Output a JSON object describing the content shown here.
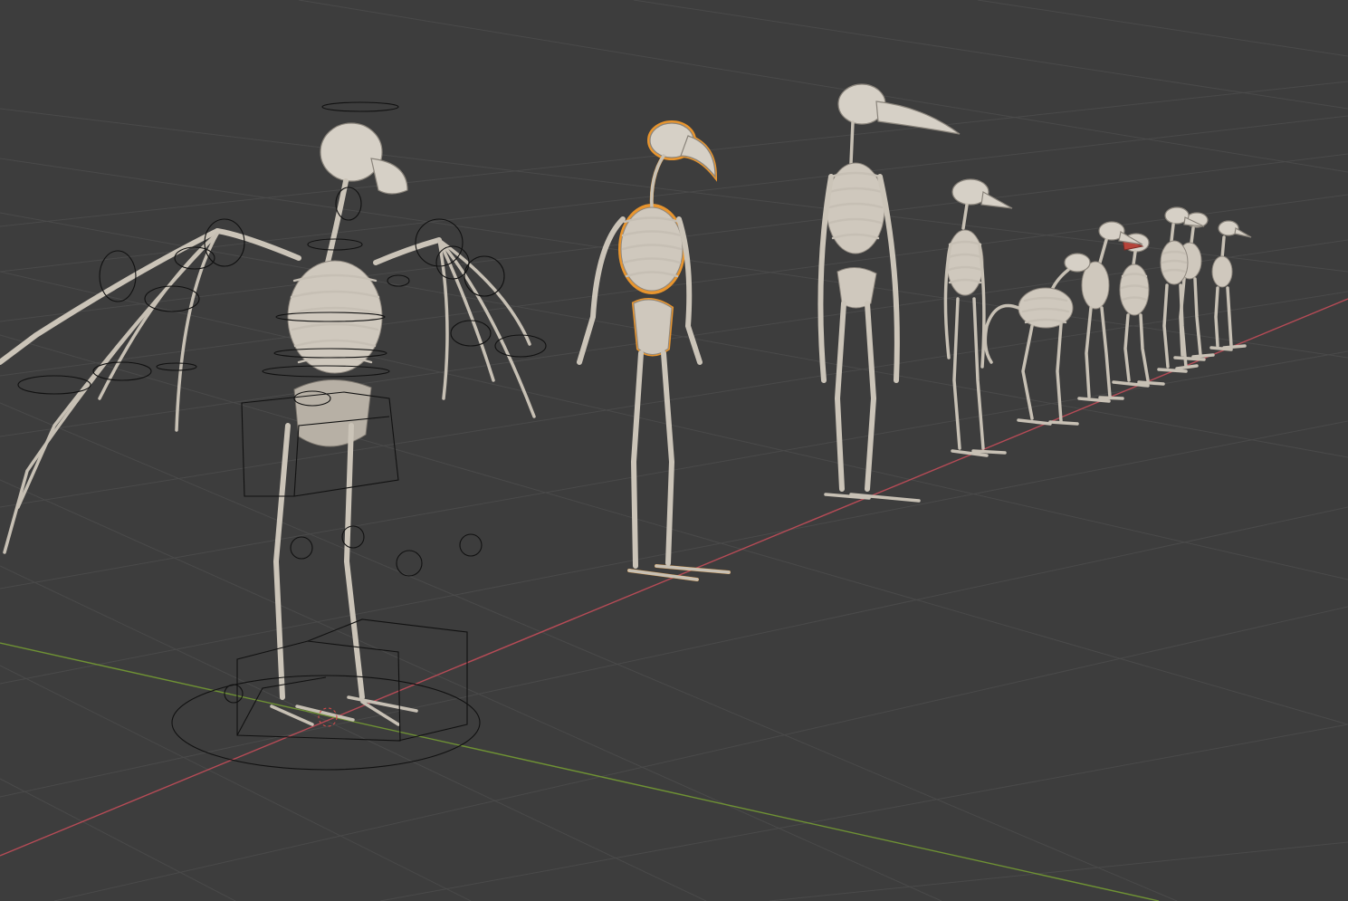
{
  "viewport": {
    "background": "#3d3d3d",
    "grid_color": "#4a4a4a",
    "x_axis_color": "#b64b56",
    "y_axis_color": "#6f9234",
    "selection_color": "#f29a2e",
    "bone_color": "#cfc8bd",
    "controller_color": "#111111"
  },
  "scene": {
    "rigged_skeleton": "winged-bird-skeleton",
    "selected_object": "bird-skeleton-selected",
    "lineup_count": 8
  }
}
